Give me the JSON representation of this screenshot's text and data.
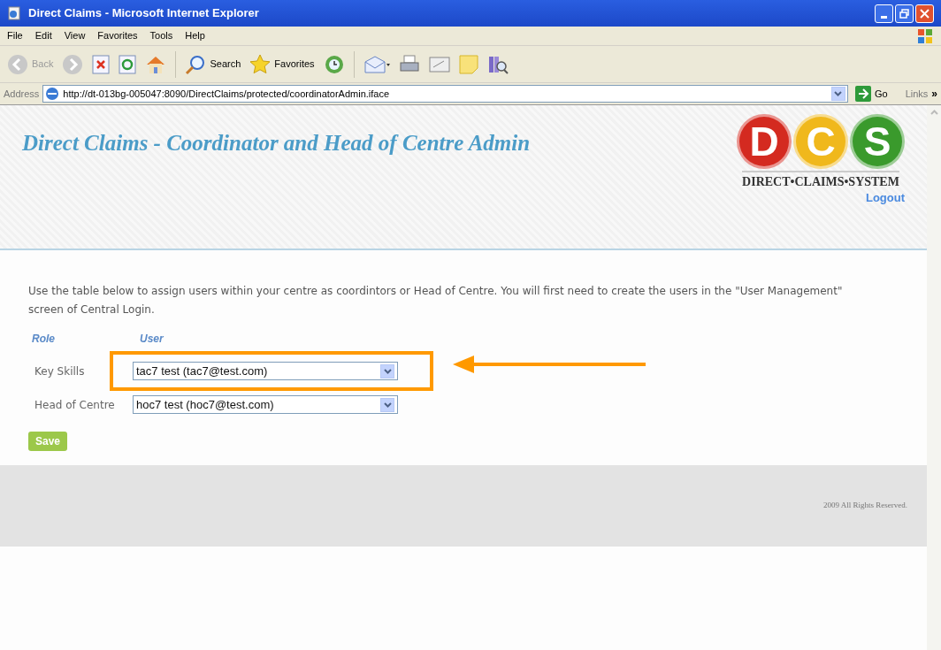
{
  "window": {
    "title": "Direct Claims - Microsoft Internet Explorer"
  },
  "menu": [
    "File",
    "Edit",
    "View",
    "Favorites",
    "Tools",
    "Help"
  ],
  "toolbar": {
    "back": "Back",
    "search": "Search",
    "favorites": "Favorites"
  },
  "address_bar": {
    "label": "Address",
    "url": "http://dt-013bg-005047:8090/DirectClaims/protected/coordinatorAdmin.iface",
    "go": "Go",
    "links": "Links",
    "more": "»"
  },
  "header": {
    "title": "Direct Claims - Coordinator and Head of Centre Admin",
    "logo_letters": [
      {
        "letter": "D",
        "color": "#d42a20"
      },
      {
        "letter": "C",
        "color": "#f0b81c"
      },
      {
        "letter": "S",
        "color": "#3a9a2c"
      }
    ],
    "logo_caption": "DIRECT•CLAIMS•SYSTEM",
    "logout": "Logout"
  },
  "intro": "Use the table below to assign users within your centre as coordintors or Head of Centre. You will first need to create the users in the \"User Management\" screen of Central Login.",
  "table": {
    "columns": [
      "Role",
      "User"
    ],
    "rows": [
      {
        "role": "Key Skills",
        "user": "tac7 test (tac7@test.com)",
        "highlighted": true
      },
      {
        "role": "Head of Centre",
        "user": "hoc7 test (hoc7@test.com)",
        "highlighted": false
      }
    ]
  },
  "save": "Save",
  "footer": "2009 All Rights Reserved."
}
